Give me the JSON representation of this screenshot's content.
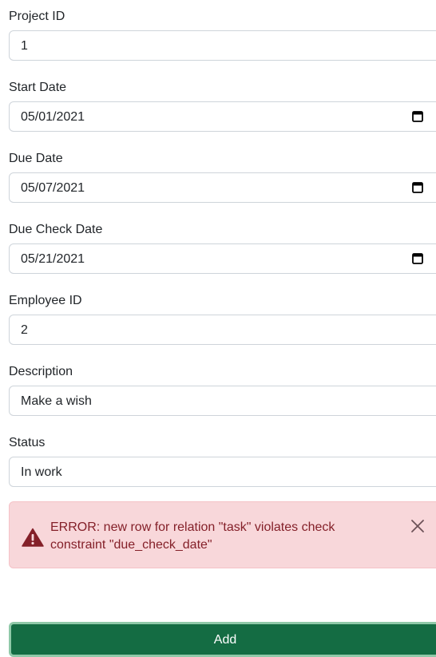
{
  "form": {
    "project_id": {
      "label": "Project ID",
      "value": "1"
    },
    "start_date": {
      "label": "Start Date",
      "value": "05/01/2021",
      "icon": "calendar-icon"
    },
    "due_date": {
      "label": "Due Date",
      "value": "05/07/2021",
      "icon": "calendar-icon"
    },
    "due_check_date": {
      "label": "Due Check Date",
      "value": "05/21/2021",
      "icon": "calendar-icon"
    },
    "employee_id": {
      "label": "Employee ID",
      "value": "2"
    },
    "description": {
      "label": "Description",
      "value": "Make a wish"
    },
    "status": {
      "label": "Status",
      "value": "In work"
    }
  },
  "alert": {
    "message": "ERROR: new row for relation \"task\" violates check constraint \"due_check_date\"",
    "icon": "warning-triangle-icon",
    "close_icon": "close-icon",
    "background": "#f8d7da",
    "text_color": "#842029"
  },
  "actions": {
    "add_label": "Add",
    "button_color": "#146c43"
  }
}
